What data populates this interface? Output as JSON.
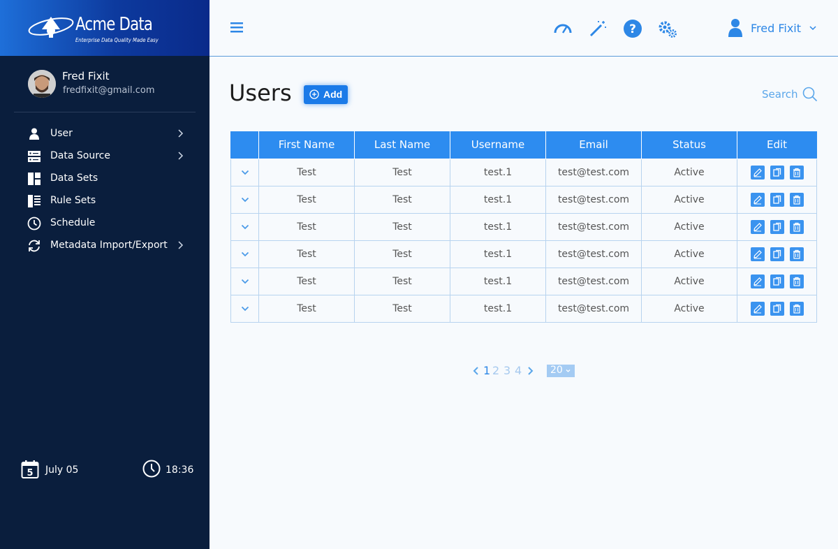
{
  "brand": {
    "name": "Acme Data",
    "tagline": "Enterprise Data Quality Made Easy"
  },
  "profile": {
    "name": "Fred Fixit",
    "email": "fredfixit@gmail.com"
  },
  "nav": {
    "items": [
      {
        "label": "User",
        "icon": "user-icon",
        "has_submenu": true
      },
      {
        "label": "Data Source",
        "icon": "server-icon",
        "has_submenu": true
      },
      {
        "label": "Data Sets",
        "icon": "grid-icon",
        "has_submenu": false
      },
      {
        "label": "Rule Sets",
        "icon": "list-icon",
        "has_submenu": false
      },
      {
        "label": "Schedule",
        "icon": "clock-icon",
        "has_submenu": false
      },
      {
        "label": "Metadata Import/Export",
        "icon": "sync-icon",
        "has_submenu": true
      }
    ]
  },
  "footer": {
    "date": "July 05",
    "calendar_day": "5",
    "time": "18:36"
  },
  "header": {
    "user_name": "Fred Fixit"
  },
  "main": {
    "title": "Users",
    "add_label": "Add",
    "search_label": "Search",
    "columns": [
      "First Name",
      "Last Name",
      "Username",
      "Email",
      "Status",
      "Edit"
    ],
    "rows": [
      [
        "Test",
        "Test",
        "test.1",
        "test@test.com",
        "Active"
      ],
      [
        "Test",
        "Test",
        "test.1",
        "test@test.com",
        "Active"
      ],
      [
        "Test",
        "Test",
        "test.1",
        "test@test.com",
        "Active"
      ],
      [
        "Test",
        "Test",
        "test.1",
        "test@test.com",
        "Active"
      ],
      [
        "Test",
        "Test",
        "test.1",
        "test@test.com",
        "Active"
      ],
      [
        "Test",
        "Test",
        "test.1",
        "test@test.com",
        "Active"
      ]
    ]
  },
  "pagination": {
    "pages": [
      "1",
      "2",
      "3",
      "4"
    ],
    "current": "1",
    "per_page": "20"
  },
  "colors": {
    "sidebar_bg": "#0a1e3d",
    "accent": "#2d8cf0",
    "link": "#2d87e6"
  }
}
